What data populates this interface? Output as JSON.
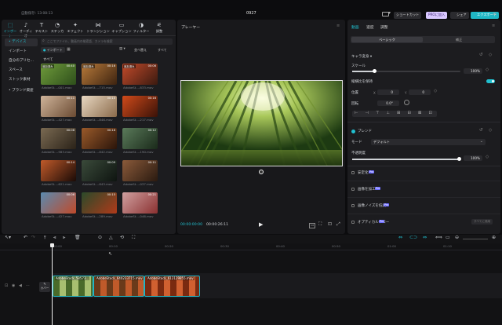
{
  "titlebar": {
    "autosave": "自動保存: 13:08:13",
    "project": "0927",
    "shortcut": "ショートカット",
    "pro": "PROに加入",
    "share": "シェア",
    "export": "エクスポート"
  },
  "toolbar": [
    {
      "icon": "import-icon",
      "label": "インポート"
    },
    {
      "icon": "audio-icon",
      "label": "オーディオ"
    },
    {
      "icon": "text-icon",
      "label": "テキスト"
    },
    {
      "icon": "sticker-icon",
      "label": "ステッカー"
    },
    {
      "icon": "effect-icon",
      "label": "エフェクト"
    },
    {
      "icon": "transition-icon",
      "label": "トランジション"
    },
    {
      "icon": "caption-icon",
      "label": "キャプション"
    },
    {
      "icon": "filter-icon",
      "label": "フィルター"
    },
    {
      "icon": "adjust-icon",
      "label": "調整"
    }
  ],
  "sidebar": [
    "• デバイス",
    "インポート",
    "自分のプリセ...",
    "スペース",
    "ストック素材",
    "• ブランド資産"
  ],
  "media": {
    "search_placeholder": "ここでファイル、動画内の検索語、カメラを検索",
    "tab": "インポート",
    "sort": "並べ替え",
    "all": "すべて",
    "filter": "すべて"
  },
  "thumbs": [
    {
      "label": "AdobeSt...-001.mov",
      "dur": "00:40",
      "badge": "追加済み"
    },
    {
      "label": "AdobeSt...-715.mov",
      "dur": "00:16",
      "badge": "追加済み"
    },
    {
      "label": "AdobeSt...-833.mov",
      "dur": "00:06",
      "badge": "追加済み"
    },
    {
      "label": "AdobeSt...-427.mov",
      "dur": "00:11",
      "badge": ""
    },
    {
      "label": "AdobeSt...-846.mov",
      "dur": "00:10",
      "badge": ""
    },
    {
      "label": "AdobeSt...-217.mov",
      "dur": "00:16",
      "badge": ""
    },
    {
      "label": "AdobeSt...-983.mov",
      "dur": "00:08",
      "badge": ""
    },
    {
      "label": "AdobeSt...-842.mov",
      "dur": "00:18",
      "badge": ""
    },
    {
      "label": "AdobeSt...-190.mov",
      "dur": "00:12",
      "badge": ""
    },
    {
      "label": "AdobeSt...-621.mov",
      "dur": "00:14",
      "badge": ""
    },
    {
      "label": "AdobeSt...-843.mov",
      "dur": "00:09",
      "badge": ""
    },
    {
      "label": "AdobeSt...-037.mov",
      "dur": "00:11",
      "badge": ""
    },
    {
      "label": "AdobeSt...-427.mov",
      "dur": "00:06",
      "badge": ""
    },
    {
      "label": "AdobeSt...-289.mov",
      "dur": "00:15",
      "badge": ""
    },
    {
      "label": "AdobeSt...-046.mov",
      "dur": "00:21",
      "badge": ""
    }
  ],
  "player": {
    "title": "プレーヤー",
    "time": "00:00:00:00",
    "total": "00:00:26:11"
  },
  "props": {
    "tabs": [
      "動画",
      "速度",
      "調整"
    ],
    "subtabs": [
      "ベーシック",
      "補正"
    ],
    "section": "キャラ変身",
    "scale_label": "スケール",
    "scale": "100%",
    "ratio_label": "縦横比を保持",
    "position_label": "位置",
    "x_label": "X",
    "x": "0",
    "y_label": "Y",
    "y": "0",
    "rotate_label": "回転",
    "rotate": "0.0°",
    "blend_label": "ブレンド",
    "mode_label": "モード",
    "mode": "デフォルト",
    "opacity_label": "不透明度",
    "opacity": "100%",
    "stabilize": "安定化",
    "enhance": "画像を加工",
    "denoise": "画像ノイズを低減",
    "optical": "オプティカルフロー",
    "badge": "Pro",
    "apply_all": "すべてに適用"
  },
  "timeline": {
    "ruler": [
      "00:00",
      "00:10",
      "00:20",
      "00:30",
      "00:40",
      "00:50",
      "01:00",
      "01:10"
    ],
    "cover": "カバー",
    "clips": [
      "AdobeStock_58573...",
      "AdobeStock_640233715.mov",
      "AdobeStock_612129855.mov"
    ]
  }
}
